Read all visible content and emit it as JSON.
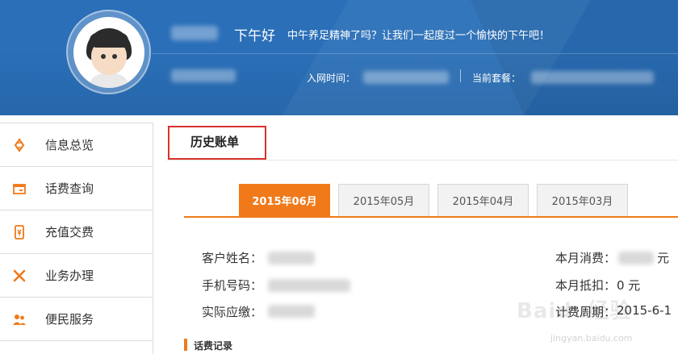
{
  "header": {
    "greeting": "下午好",
    "message": "中午养足精神了吗？让我们一起度过一个愉快的下午吧！",
    "join_time_label": "入网时间：",
    "plan_label": "当前套餐：",
    "bg_color": "#2a6fb8"
  },
  "sidebar": {
    "items": [
      {
        "label": "信息总览",
        "icon": "info-overview-icon"
      },
      {
        "label": "话费查询",
        "icon": "bill-query-icon"
      },
      {
        "label": "充值交费",
        "icon": "recharge-icon"
      },
      {
        "label": "业务办理",
        "icon": "tools-icon"
      },
      {
        "label": "便民服务",
        "icon": "people-icon"
      }
    ],
    "accent_color": "#f07a1a"
  },
  "main": {
    "title": "历史账单",
    "tabs": [
      {
        "label": "2015年06月",
        "active": true
      },
      {
        "label": "2015年05月",
        "active": false
      },
      {
        "label": "2015年04月",
        "active": false
      },
      {
        "label": "2015年03月",
        "active": false
      }
    ],
    "fields_left": {
      "customer_name_label": "客户姓名：",
      "phone_label": "手机号码：",
      "amount_due_label": "实际应缴："
    },
    "fields_right": {
      "monthly_spend_label": "本月消费：",
      "monthly_spend_unit": "元",
      "monthly_deduction_label": "本月抵扣：",
      "monthly_deduction_value": "0 元",
      "billing_period_label": "计费周期：",
      "billing_period_value": "2015-6-1"
    },
    "section_label": "话费记录"
  },
  "watermark": {
    "text": "Baidu经验",
    "sub": "jingyan.baidu.com"
  }
}
